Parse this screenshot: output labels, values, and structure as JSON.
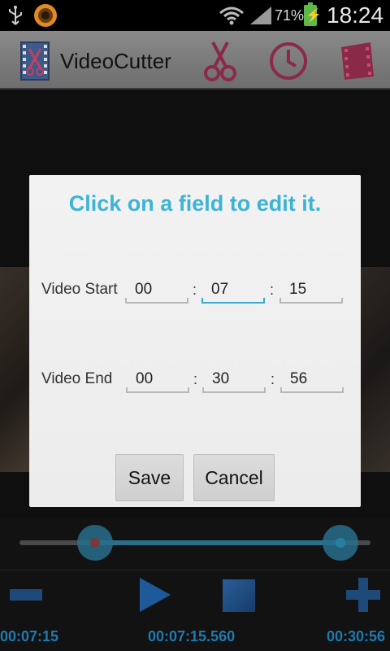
{
  "status_bar": {
    "battery_percent": "71%",
    "battery_charging_icon": "lightning-icon",
    "time": "18:24",
    "icons": [
      "usb-icon",
      "app-notification-icon",
      "wifi-icon",
      "signal-icon",
      "battery-icon"
    ]
  },
  "action_bar": {
    "title": "VideoCutter",
    "logo_icon": "film-scissors-icon",
    "actions": [
      "scissors-icon",
      "clock-icon",
      "film-icon"
    ]
  },
  "dialog": {
    "title": "Click on a field to edit it.",
    "video_start": {
      "label": "Video Start",
      "hours": "00",
      "minutes": "07",
      "seconds": "15",
      "focused_field": "minutes"
    },
    "video_end": {
      "label": "Video End",
      "hours": "00",
      "minutes": "30",
      "seconds": "56"
    },
    "separator": ":",
    "save_label": "Save",
    "cancel_label": "Cancel"
  },
  "player": {
    "start_time": "00:07:15",
    "current_time": "00:07:15.560",
    "end_time": "00:30:56",
    "controls": [
      "minus-icon",
      "play-icon",
      "stop-icon",
      "plus-icon"
    ],
    "colors": {
      "accent": "#1f7ab0",
      "title_accent": "#3cb4d6"
    }
  }
}
